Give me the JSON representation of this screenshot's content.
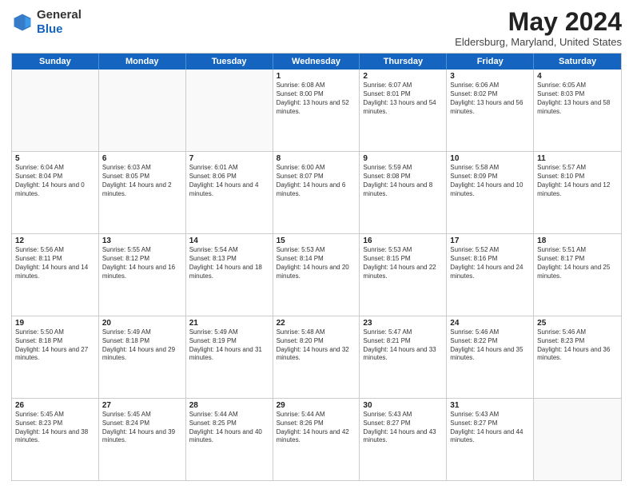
{
  "header": {
    "logo_general": "General",
    "logo_blue": "Blue",
    "month_title": "May 2024",
    "location": "Eldersburg, Maryland, United States"
  },
  "days_of_week": [
    "Sunday",
    "Monday",
    "Tuesday",
    "Wednesday",
    "Thursday",
    "Friday",
    "Saturday"
  ],
  "weeks": [
    [
      {
        "day": "",
        "empty": true
      },
      {
        "day": "",
        "empty": true
      },
      {
        "day": "",
        "empty": true
      },
      {
        "day": "1",
        "sunrise": "6:08 AM",
        "sunset": "8:00 PM",
        "daylight": "13 hours and 52 minutes."
      },
      {
        "day": "2",
        "sunrise": "6:07 AM",
        "sunset": "8:01 PM",
        "daylight": "13 hours and 54 minutes."
      },
      {
        "day": "3",
        "sunrise": "6:06 AM",
        "sunset": "8:02 PM",
        "daylight": "13 hours and 56 minutes."
      },
      {
        "day": "4",
        "sunrise": "6:05 AM",
        "sunset": "8:03 PM",
        "daylight": "13 hours and 58 minutes."
      }
    ],
    [
      {
        "day": "5",
        "sunrise": "6:04 AM",
        "sunset": "8:04 PM",
        "daylight": "14 hours and 0 minutes."
      },
      {
        "day": "6",
        "sunrise": "6:03 AM",
        "sunset": "8:05 PM",
        "daylight": "14 hours and 2 minutes."
      },
      {
        "day": "7",
        "sunrise": "6:01 AM",
        "sunset": "8:06 PM",
        "daylight": "14 hours and 4 minutes."
      },
      {
        "day": "8",
        "sunrise": "6:00 AM",
        "sunset": "8:07 PM",
        "daylight": "14 hours and 6 minutes."
      },
      {
        "day": "9",
        "sunrise": "5:59 AM",
        "sunset": "8:08 PM",
        "daylight": "14 hours and 8 minutes."
      },
      {
        "day": "10",
        "sunrise": "5:58 AM",
        "sunset": "8:09 PM",
        "daylight": "14 hours and 10 minutes."
      },
      {
        "day": "11",
        "sunrise": "5:57 AM",
        "sunset": "8:10 PM",
        "daylight": "14 hours and 12 minutes."
      }
    ],
    [
      {
        "day": "12",
        "sunrise": "5:56 AM",
        "sunset": "8:11 PM",
        "daylight": "14 hours and 14 minutes."
      },
      {
        "day": "13",
        "sunrise": "5:55 AM",
        "sunset": "8:12 PM",
        "daylight": "14 hours and 16 minutes."
      },
      {
        "day": "14",
        "sunrise": "5:54 AM",
        "sunset": "8:13 PM",
        "daylight": "14 hours and 18 minutes."
      },
      {
        "day": "15",
        "sunrise": "5:53 AM",
        "sunset": "8:14 PM",
        "daylight": "14 hours and 20 minutes."
      },
      {
        "day": "16",
        "sunrise": "5:53 AM",
        "sunset": "8:15 PM",
        "daylight": "14 hours and 22 minutes."
      },
      {
        "day": "17",
        "sunrise": "5:52 AM",
        "sunset": "8:16 PM",
        "daylight": "14 hours and 24 minutes."
      },
      {
        "day": "18",
        "sunrise": "5:51 AM",
        "sunset": "8:17 PM",
        "daylight": "14 hours and 25 minutes."
      }
    ],
    [
      {
        "day": "19",
        "sunrise": "5:50 AM",
        "sunset": "8:18 PM",
        "daylight": "14 hours and 27 minutes."
      },
      {
        "day": "20",
        "sunrise": "5:49 AM",
        "sunset": "8:18 PM",
        "daylight": "14 hours and 29 minutes."
      },
      {
        "day": "21",
        "sunrise": "5:49 AM",
        "sunset": "8:19 PM",
        "daylight": "14 hours and 31 minutes."
      },
      {
        "day": "22",
        "sunrise": "5:48 AM",
        "sunset": "8:20 PM",
        "daylight": "14 hours and 32 minutes."
      },
      {
        "day": "23",
        "sunrise": "5:47 AM",
        "sunset": "8:21 PM",
        "daylight": "14 hours and 33 minutes."
      },
      {
        "day": "24",
        "sunrise": "5:46 AM",
        "sunset": "8:22 PM",
        "daylight": "14 hours and 35 minutes."
      },
      {
        "day": "25",
        "sunrise": "5:46 AM",
        "sunset": "8:23 PM",
        "daylight": "14 hours and 36 minutes."
      }
    ],
    [
      {
        "day": "26",
        "sunrise": "5:45 AM",
        "sunset": "8:23 PM",
        "daylight": "14 hours and 38 minutes."
      },
      {
        "day": "27",
        "sunrise": "5:45 AM",
        "sunset": "8:24 PM",
        "daylight": "14 hours and 39 minutes."
      },
      {
        "day": "28",
        "sunrise": "5:44 AM",
        "sunset": "8:25 PM",
        "daylight": "14 hours and 40 minutes."
      },
      {
        "day": "29",
        "sunrise": "5:44 AM",
        "sunset": "8:26 PM",
        "daylight": "14 hours and 42 minutes."
      },
      {
        "day": "30",
        "sunrise": "5:43 AM",
        "sunset": "8:27 PM",
        "daylight": "14 hours and 43 minutes."
      },
      {
        "day": "31",
        "sunrise": "5:43 AM",
        "sunset": "8:27 PM",
        "daylight": "14 hours and 44 minutes."
      },
      {
        "day": "",
        "empty": true
      }
    ]
  ]
}
